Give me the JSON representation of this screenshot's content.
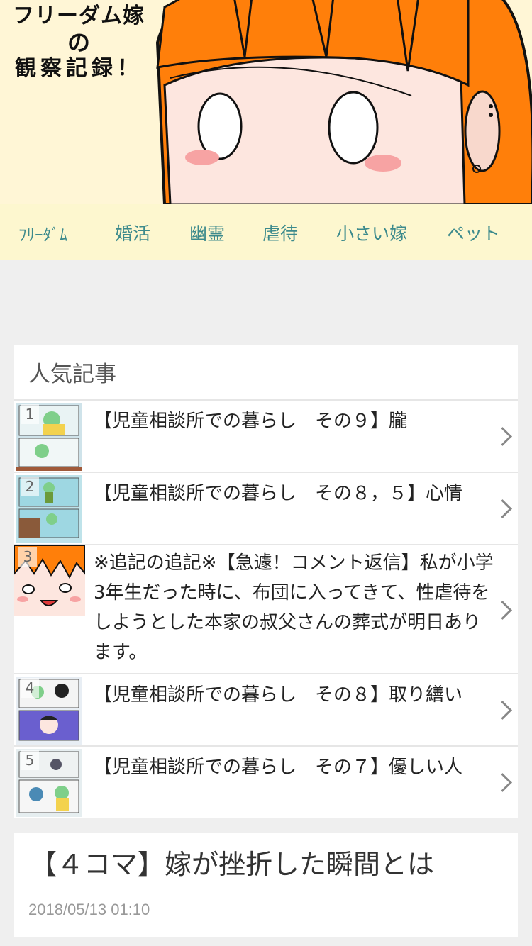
{
  "header": {
    "logo_line1": "フリーダム嫁",
    "logo_line2": "の",
    "logo_line3": "観察記録！"
  },
  "nav": {
    "items": [
      {
        "label": "ﾌﾘｰﾀﾞﾑ"
      },
      {
        "label": "婚活"
      },
      {
        "label": "幽霊"
      },
      {
        "label": "虐待"
      },
      {
        "label": "小さい嫁"
      },
      {
        "label": "ペット"
      }
    ]
  },
  "popular": {
    "title": "人気記事",
    "items": [
      {
        "rank": "1",
        "title": "【児童相談所での暮らし　その９】朧"
      },
      {
        "rank": "2",
        "title": "【児童相談所での暮らし　その８，５】心情"
      },
      {
        "rank": "3",
        "title": "※追記の追記※【急遽！コメント返信】私が小学3年生だった時に、布団に入ってきて、性虐待をしようとした本家の叔父さんの葬式が明日あります。"
      },
      {
        "rank": "4",
        "title": "【児童相談所での暮らし　その８】取り繕い"
      },
      {
        "rank": "5",
        "title": "【児童相談所での暮らし　その７】優しい人"
      }
    ]
  },
  "article": {
    "title": "【４コマ】嫁が挫折した瞬間とは",
    "date": "2018/05/13 01:10"
  },
  "colors": {
    "header_bg": "#fff6d6",
    "nav_bg": "#fdf7cf",
    "nav_text": "#3c8a8c",
    "hair": "#ff7f0a"
  }
}
